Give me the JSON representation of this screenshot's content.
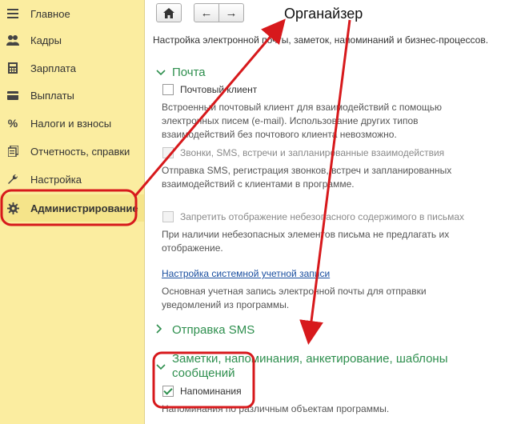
{
  "sidebar": {
    "items": [
      {
        "label": "Главное",
        "icon": "menu-icon"
      },
      {
        "label": "Кадры",
        "icon": "people-icon"
      },
      {
        "label": "Зарплата",
        "icon": "calculator-icon"
      },
      {
        "label": "Выплаты",
        "icon": "wallet-icon"
      },
      {
        "label": "Налоги и взносы",
        "icon": "percent-icon"
      },
      {
        "label": "Отчетность, справки",
        "icon": "reports-icon"
      },
      {
        "label": "Настройка",
        "icon": "wrench-icon"
      },
      {
        "label": "Администрирование",
        "icon": "gear-icon"
      }
    ]
  },
  "toolbar": {
    "home_glyph": "⌂",
    "back_glyph": "←",
    "forward_glyph": "→"
  },
  "page": {
    "title": "Органайзер",
    "description": "Настройка электронной почты, заметок, напоминаний и бизнес-процессов."
  },
  "mail": {
    "header": "Почта",
    "client_label": "Почтовый клиент",
    "client_hint_1": "Встроенный почтовый клиент для взаимодействий с помощью",
    "client_hint_2": "электронных писем (e-mail). Использование других типов",
    "client_hint_3": "взаимодействий без почтового клиента невозможно.",
    "calls_label": "Звонки, SMS, встречи и запланированные взаимодействия",
    "calls_hint_1": "Отправка SMS, регистрация звонков, встреч и запланированных",
    "calls_hint_2": "взаимодействий с клиентами в программе.",
    "unsafe_label": "Запретить отображение небезопасного содержимого в письмах",
    "unsafe_hint_1": "При наличии небезопасных элементов письма не предлагать их",
    "unsafe_hint_2": "отображение.",
    "account_link": "Настройка системной учетной записи",
    "account_hint_1": "Основная учетная запись электронной почты для отправки",
    "account_hint_2": "уведомлений из программы."
  },
  "sms": {
    "header": "Отправка SMS"
  },
  "notes": {
    "header_1": "Заметки, напоминания, анкетирование, шаблоны",
    "header_2": "сообщений",
    "reminders_label": "Напоминания",
    "reminders_hint": "Напоминания по различным объектам программы."
  },
  "colors": {
    "sidebar": "#fbeda0",
    "section": "#2e8f4e",
    "annotation": "#d7191c",
    "link": "#1a4fa0"
  }
}
